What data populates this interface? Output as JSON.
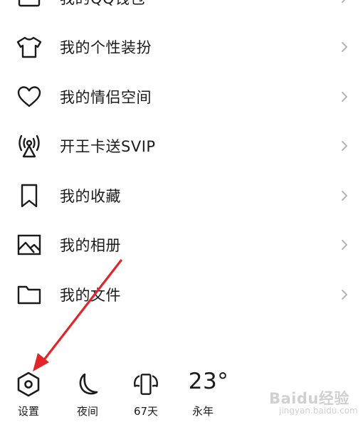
{
  "menu": {
    "items": [
      {
        "label": "我的QQ钱包",
        "icon": "wallet-icon"
      },
      {
        "label": "我的个性装扮",
        "icon": "tshirt-icon"
      },
      {
        "label": "我的情侣空间",
        "icon": "heart-icon"
      },
      {
        "label": "开王卡送SVIP",
        "icon": "signal-tower-icon"
      },
      {
        "label": "我的收藏",
        "icon": "bookmark-icon"
      },
      {
        "label": "我的相册",
        "icon": "image-icon"
      },
      {
        "label": "我的文件",
        "icon": "folder-icon"
      }
    ]
  },
  "bottom_bar": {
    "settings_label": "设置",
    "night_label": "夜间",
    "days_label": "67天",
    "weather_temp": "23°",
    "weather_city": "永年"
  },
  "watermark": {
    "text": "Baidu经验",
    "sub": "jingyan.baidu.com"
  },
  "colors": {
    "arrow": "#e0262a",
    "text": "#1b1b1b",
    "chevron": "#b5b5b5",
    "background": "#ffffff"
  }
}
